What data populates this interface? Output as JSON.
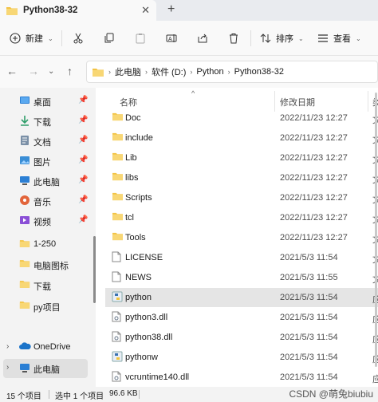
{
  "window": {
    "tab_title": "Python38-32",
    "close_label": "✕",
    "new_tab_label": "+"
  },
  "toolbar": {
    "new_label": "新建",
    "sort_label": "排序",
    "view_label": "查看"
  },
  "address": {
    "breadcrumbs": [
      "此电脑",
      "软件 (D:)",
      "Python",
      "Python38-32"
    ]
  },
  "sidebar": {
    "items": [
      {
        "label": "桌面",
        "icon": "desktop-icon",
        "pinned": true
      },
      {
        "label": "下载",
        "icon": "download-icon",
        "pinned": true
      },
      {
        "label": "文档",
        "icon": "document-icon",
        "pinned": true
      },
      {
        "label": "图片",
        "icon": "picture-icon",
        "pinned": true
      },
      {
        "label": "此电脑",
        "icon": "computer-icon",
        "pinned": true
      },
      {
        "label": "音乐",
        "icon": "music-icon",
        "pinned": true
      },
      {
        "label": "视频",
        "icon": "video-icon",
        "pinned": true
      },
      {
        "label": "1-250",
        "icon": "folder-icon",
        "pinned": false
      },
      {
        "label": "电脑图标",
        "icon": "folder-icon",
        "pinned": false
      },
      {
        "label": "下载",
        "icon": "folder-icon",
        "pinned": false
      },
      {
        "label": "py项目",
        "icon": "folder-icon",
        "pinned": false
      }
    ],
    "bottom_items": [
      {
        "label": "OneDrive",
        "icon": "cloud-icon"
      },
      {
        "label": "此电脑",
        "icon": "computer-icon",
        "selected": true
      }
    ]
  },
  "file_list": {
    "columns": {
      "name": "名称",
      "modified": "修改日期",
      "type": "类"
    },
    "rows": [
      {
        "name": "Doc",
        "modified": "2022/11/23 12:27",
        "type": "文",
        "icon": "folder-icon"
      },
      {
        "name": "include",
        "modified": "2022/11/23 12:27",
        "type": "文",
        "icon": "folder-icon"
      },
      {
        "name": "Lib",
        "modified": "2022/11/23 12:27",
        "type": "文",
        "icon": "folder-icon"
      },
      {
        "name": "libs",
        "modified": "2022/11/23 12:27",
        "type": "文",
        "icon": "folder-icon"
      },
      {
        "name": "Scripts",
        "modified": "2022/11/23 12:27",
        "type": "文",
        "icon": "folder-icon"
      },
      {
        "name": "tcl",
        "modified": "2022/11/23 12:27",
        "type": "文",
        "icon": "folder-icon"
      },
      {
        "name": "Tools",
        "modified": "2022/11/23 12:27",
        "type": "文",
        "icon": "folder-icon"
      },
      {
        "name": "LICENSE",
        "modified": "2021/5/3 11:54",
        "type": "文",
        "icon": "file-icon"
      },
      {
        "name": "NEWS",
        "modified": "2021/5/3 11:55",
        "type": "文",
        "icon": "file-icon"
      },
      {
        "name": "python",
        "modified": "2021/5/3 11:54",
        "type": "应",
        "icon": "python-icon",
        "selected": true
      },
      {
        "name": "python3.dll",
        "modified": "2021/5/3 11:54",
        "type": "应",
        "icon": "dll-icon"
      },
      {
        "name": "python38.dll",
        "modified": "2021/5/3 11:54",
        "type": "应",
        "icon": "dll-icon"
      },
      {
        "name": "pythonw",
        "modified": "2021/5/3 11:54",
        "type": "应",
        "icon": "python-icon"
      },
      {
        "name": "vcruntime140.dll",
        "modified": "2021/5/3 11:54",
        "type": "应",
        "icon": "dll-icon"
      }
    ]
  },
  "status": {
    "item_count": "15 个项目",
    "selection": "选中 1 个项目",
    "size": "96.6 KB",
    "watermark": "CSDN @萌兔biubiu"
  },
  "colors": {
    "folder": "#f3c344",
    "accent": "#0067c0",
    "selected_bg": "#e5e5e5"
  }
}
